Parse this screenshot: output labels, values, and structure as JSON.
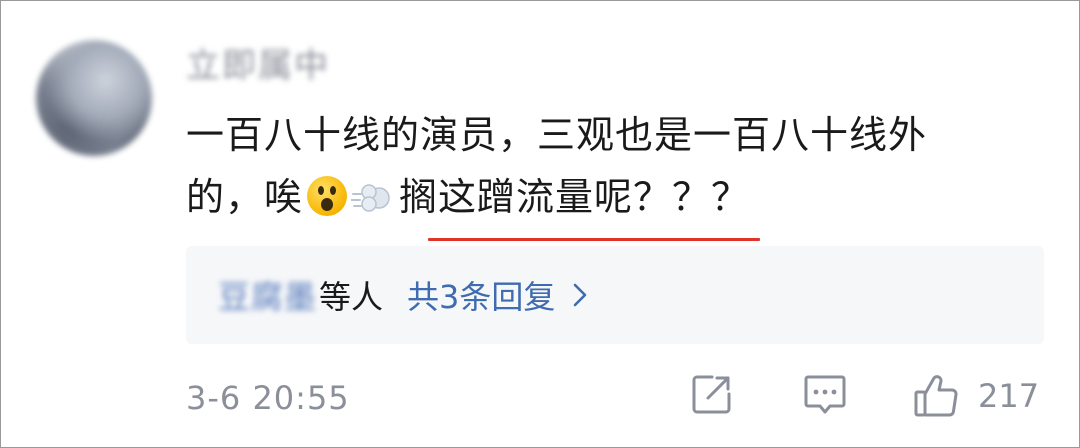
{
  "comment": {
    "username": "立即属中",
    "text_line1": "一百八十线的演员，三观也是一百八十线外",
    "text_line2_before": "的，唉",
    "text_line2_after": "搁这蹭流量呢？？？",
    "emoji_1": "astonished-face-icon",
    "emoji_2": "dash-puff-icon",
    "highlight_color": "#e0342a"
  },
  "replies": {
    "blurred_names": "豆腐墨",
    "suffix": "等人",
    "total_label": "共3条回复"
  },
  "footer": {
    "timestamp": "3-6 20:55",
    "like_count": "217"
  },
  "colors": {
    "link": "#3f6bb0",
    "muted": "#8a8f99",
    "reply_bg": "#f6f7f9"
  }
}
